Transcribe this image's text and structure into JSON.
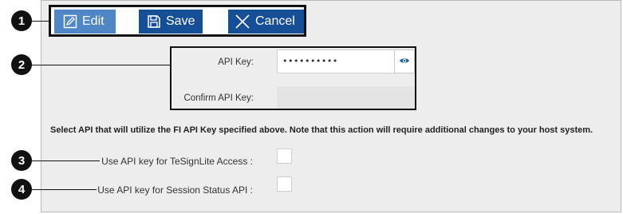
{
  "toolbar": {
    "edit_label": "Edit",
    "save_label": "Save",
    "cancel_label": "Cancel"
  },
  "api_key": {
    "label": "API Key:",
    "masked_value": "••••••••••",
    "confirm_label": "Confirm API Key:"
  },
  "notice": "Select API that will utilize the FI API Key specified above. Note that this action will require additional changes to your host system.",
  "options": [
    {
      "label": "Use API key for TeSignLite Access :",
      "checked": false
    },
    {
      "label": "Use API key for Session Status API :",
      "checked": false
    }
  ],
  "callouts": [
    "1",
    "2",
    "3",
    "4"
  ],
  "icons": {
    "edit": "edit-icon",
    "save": "save-icon",
    "cancel": "close-icon",
    "show_password": "eye-icon"
  },
  "colors": {
    "primary_button": "#174f97",
    "edit_button": "#4f86c6",
    "panel_background": "#ededed",
    "eye_icon": "#1d5ea8"
  }
}
